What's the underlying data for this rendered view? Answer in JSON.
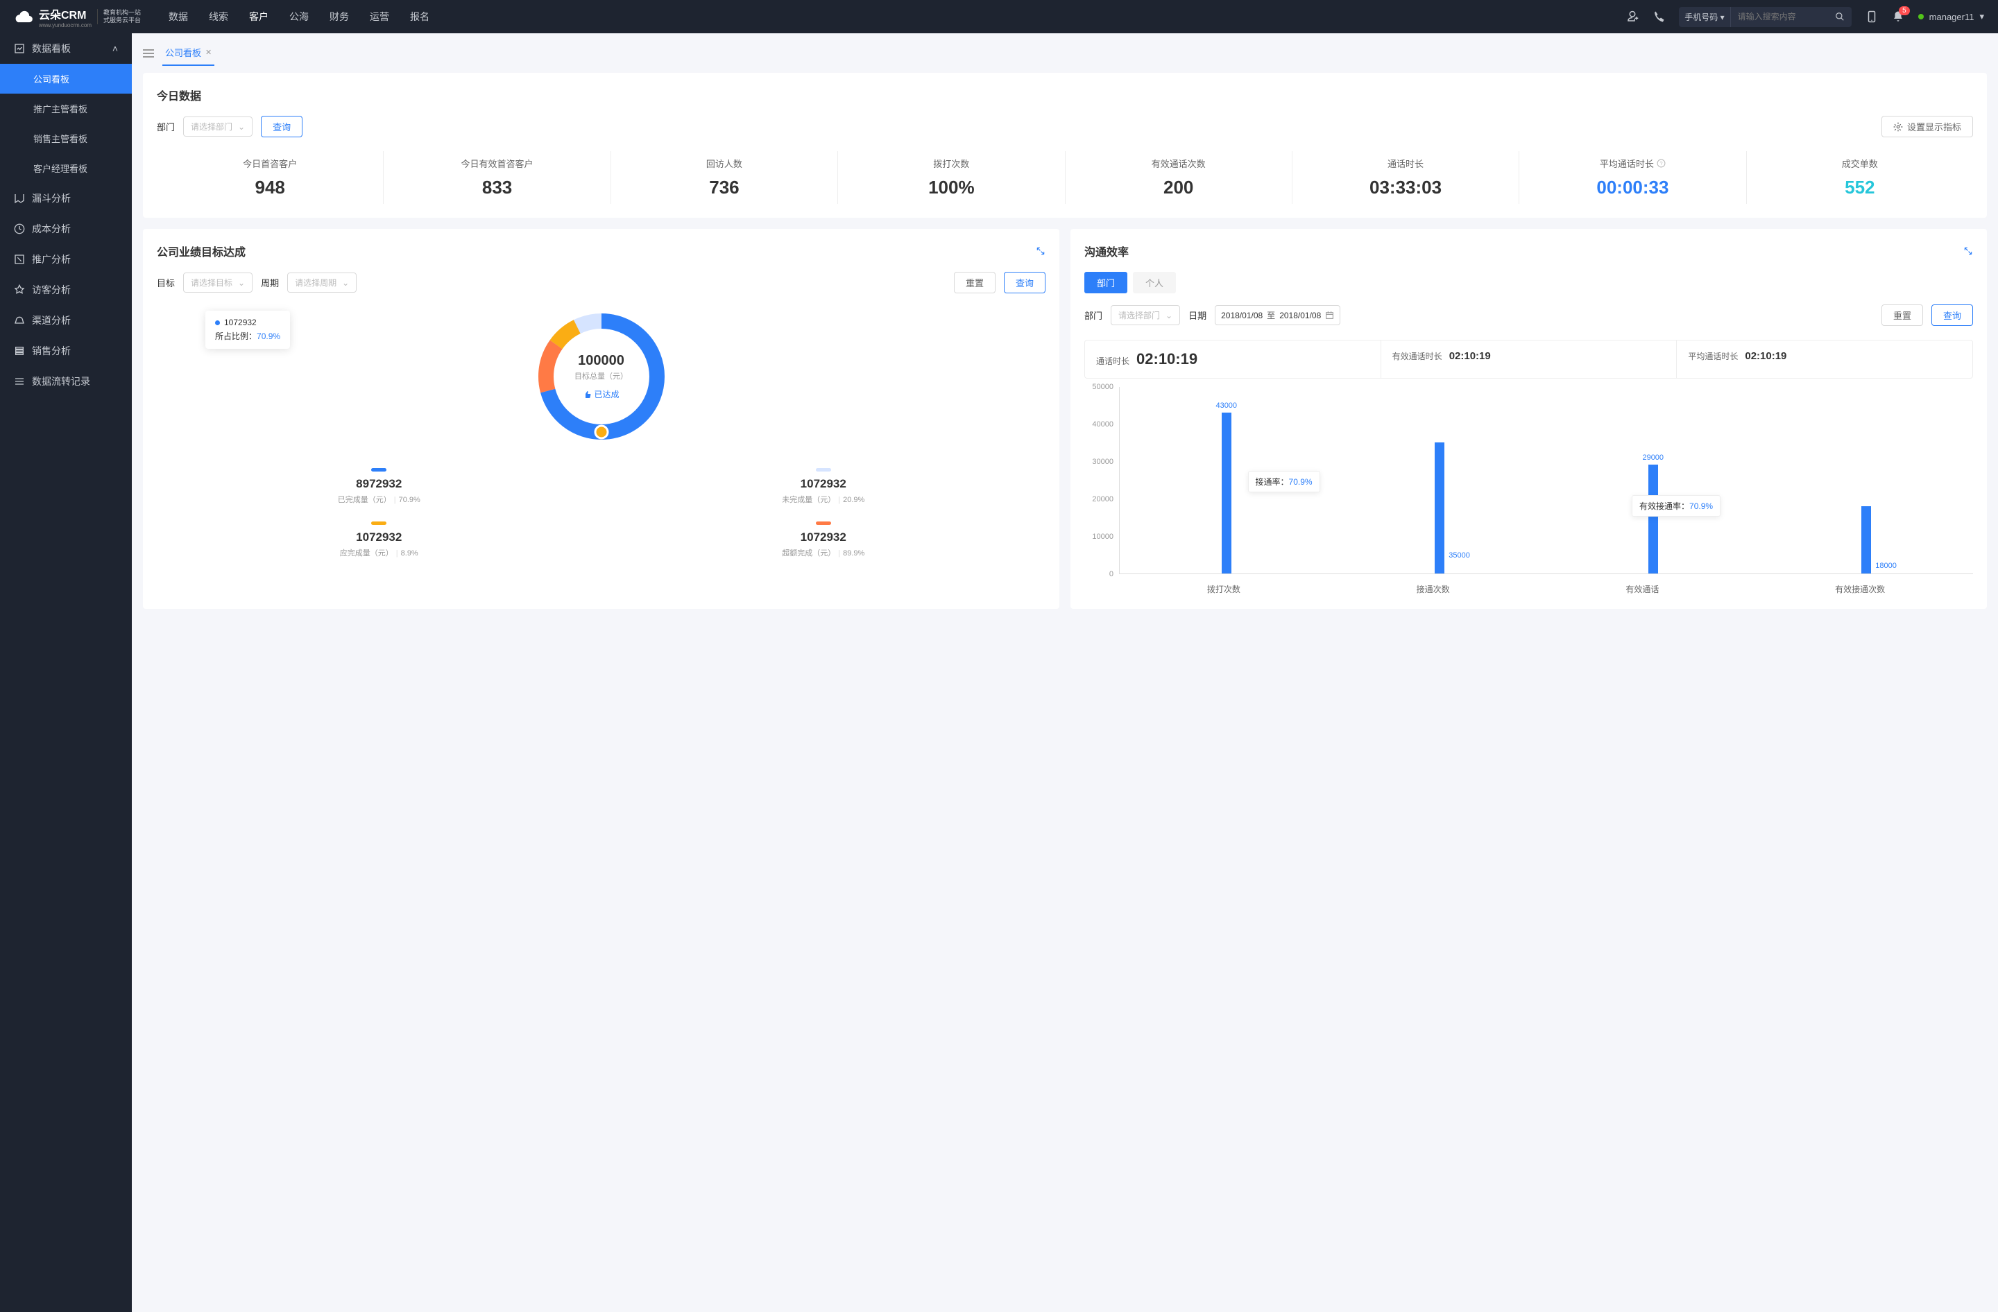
{
  "brand": {
    "name": "云朵CRM",
    "sub1": "教育机构一站",
    "sub2": "式服务云平台",
    "url": "www.yunduocrm.com"
  },
  "topnav": [
    "数据",
    "线索",
    "客户",
    "公海",
    "财务",
    "运营",
    "报名"
  ],
  "topnav_active": 2,
  "search": {
    "type": "手机号码",
    "placeholder": "请输入搜索内容"
  },
  "notif_count": "5",
  "user": "manager11",
  "sidebar": {
    "group": "数据看板",
    "children": [
      "公司看板",
      "推广主管看板",
      "销售主管看板",
      "客户经理看板"
    ],
    "active_child": 0,
    "items": [
      "漏斗分析",
      "成本分析",
      "推广分析",
      "访客分析",
      "渠道分析",
      "销售分析",
      "数据流转记录"
    ]
  },
  "tab": "公司看板",
  "today": {
    "title": "今日数据",
    "dept_label": "部门",
    "dept_placeholder": "请选择部门",
    "query": "查询",
    "settings": "设置显示指标",
    "metrics": [
      {
        "label": "今日首咨客户",
        "value": "948"
      },
      {
        "label": "今日有效首咨客户",
        "value": "833"
      },
      {
        "label": "回访人数",
        "value": "736"
      },
      {
        "label": "拨打次数",
        "value": "100%"
      },
      {
        "label": "有效通话次数",
        "value": "200"
      },
      {
        "label": "通话时长",
        "value": "03:33:03"
      },
      {
        "label": "平均通话时长",
        "value": "00:00:33",
        "info": true,
        "blue": true
      },
      {
        "label": "成交单数",
        "value": "552",
        "cyan": true
      }
    ]
  },
  "goal": {
    "title": "公司业绩目标达成",
    "target_label": "目标",
    "target_placeholder": "请选择目标",
    "period_label": "周期",
    "period_placeholder": "请选择周期",
    "reset": "重置",
    "query": "查询",
    "center_value": "100000",
    "center_label": "目标总量（元）",
    "achieved": "已达成",
    "tooltip_value": "1072932",
    "tooltip_ratio_label": "所占比例：",
    "tooltip_ratio": "70.9%",
    "legends": [
      {
        "color": "#2d7ff9",
        "value": "8972932",
        "desc": "已完成量（元）",
        "pct": "70.9%"
      },
      {
        "color": "#d6e4ff",
        "value": "1072932",
        "desc": "未完成量（元）",
        "pct": "20.9%"
      },
      {
        "color": "#faad14",
        "value": "1072932",
        "desc": "应完成量（元）",
        "pct": "8.9%"
      },
      {
        "color": "#ff7a45",
        "value": "1072932",
        "desc": "超额完成（元）",
        "pct": "89.9%"
      }
    ]
  },
  "comm": {
    "title": "沟通效率",
    "seg_dept": "部门",
    "seg_person": "个人",
    "dept_label": "部门",
    "dept_placeholder": "请选择部门",
    "date_label": "日期",
    "date_from": "2018/01/08",
    "date_to": "2018/01/08",
    "date_sep": "至",
    "reset": "重置",
    "query": "查询",
    "summary": [
      {
        "label": "通话时长",
        "value": "02:10:19",
        "big": true
      },
      {
        "label": "有效通话时长",
        "value": "02:10:19"
      },
      {
        "label": "平均通话时长",
        "value": "02:10:19"
      }
    ],
    "rate1_label": "接通率：",
    "rate1_value": "70.9%",
    "rate2_label": "有效接通率：",
    "rate2_value": "70.9%"
  },
  "chart_data": {
    "type": "bar",
    "categories": [
      "拨打次数",
      "接通次数",
      "有效通话",
      "有效接通次数"
    ],
    "values": [
      43000,
      35000,
      29000,
      18000
    ],
    "labels": [
      "43000",
      "35000",
      "29000",
      "18000"
    ],
    "ylim": [
      0,
      50000
    ],
    "yticks": [
      0,
      10000,
      20000,
      30000,
      40000,
      50000
    ]
  }
}
